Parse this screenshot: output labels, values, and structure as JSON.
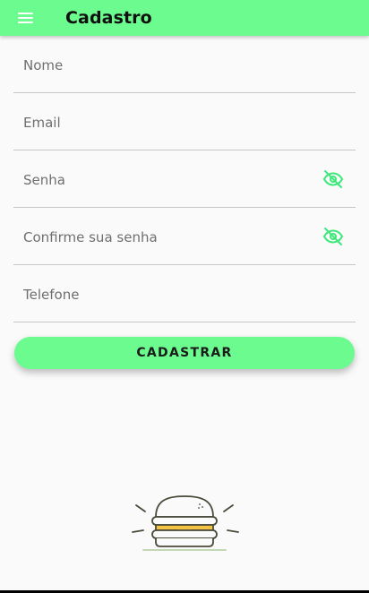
{
  "appbar": {
    "menu_icon": "menu-icon",
    "title": "Cadastro",
    "color": "#6cfb8e"
  },
  "form": {
    "nome_placeholder": "Nome",
    "email_placeholder": "Email",
    "senha_placeholder": "Senha",
    "confirm_placeholder": "Confirme sua senha",
    "telefone_placeholder": "Telefone",
    "password_toggle_icon": "eye-off-icon",
    "submit_label": "CADASTRAR"
  },
  "logo": {
    "icon": "burger-icon"
  }
}
